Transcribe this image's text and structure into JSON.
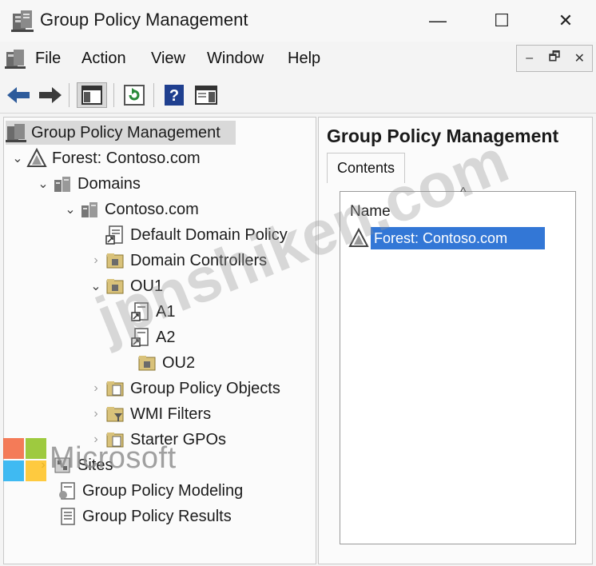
{
  "window": {
    "title": "Group Policy Management",
    "controls": {
      "minimize": "—",
      "maximize": "☐",
      "close": "✕"
    }
  },
  "menu": {
    "items": [
      "File",
      "Action",
      "View",
      "Window",
      "Help"
    ],
    "mdi_controls": {
      "minimize": "–",
      "restore": "🗗",
      "close": "✕"
    }
  },
  "toolbar": {
    "buttons": [
      "back-arrow-icon",
      "forward-arrow-icon",
      "show-hide-console-tree-icon",
      "refresh-icon",
      "help-icon",
      "show-hide-action-pane-icon"
    ]
  },
  "tree": {
    "root": "Group Policy Management",
    "forest": "Forest: Contoso.com",
    "domains": "Domains",
    "domain": "Contoso.com",
    "default_domain_policy": "Default Domain Policy",
    "domain_controllers": "Domain Controllers",
    "ou1": "OU1",
    "a1": "A1",
    "a2": "A2",
    "ou2": "OU2",
    "gpo": "Group Policy Objects",
    "wmi": "WMI Filters",
    "starter": "Starter GPOs",
    "sites": "Sites",
    "modeling": "Group Policy Modeling",
    "results": "Group Policy Results"
  },
  "right_pane": {
    "title": "Group Policy Management",
    "tab": "Contents",
    "column_header": "Name",
    "sort_indicator": "^",
    "rows": [
      "Forest: Contoso.com"
    ]
  },
  "overlay": {
    "brand_text": "Microsoft",
    "watermark": "jpnshiken.com"
  },
  "colors": {
    "selection": "#3377d6",
    "tree_selected": "#d9d9d9",
    "ms_red": "#f25022",
    "ms_green": "#7fba00",
    "ms_blue": "#00a4ef",
    "ms_yellow": "#ffb900"
  }
}
